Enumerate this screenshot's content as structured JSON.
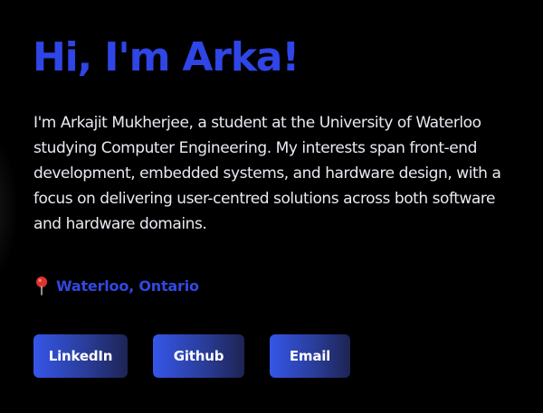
{
  "hero": {
    "title": "Hi, I'm Arka!",
    "bio": "I'm Arkajit Mukherjee, a student at the University of Waterloo studying Computer Engineering. My interests span front-end development, embedded systems, and hardware design, with a focus on delivering user-centred solutions across both software and hardware domains."
  },
  "location": {
    "icon": "map-pin-icon",
    "text": "Waterloo, Ontario"
  },
  "links": {
    "linkedin": "LinkedIn",
    "github": "Github",
    "email": "Email"
  },
  "colors": {
    "background": "#000000",
    "accent": "#2f45e6",
    "body_text": "#e9e9f2",
    "button_gradient_start": "#3556e8",
    "button_gradient_end": "#1d2453"
  }
}
